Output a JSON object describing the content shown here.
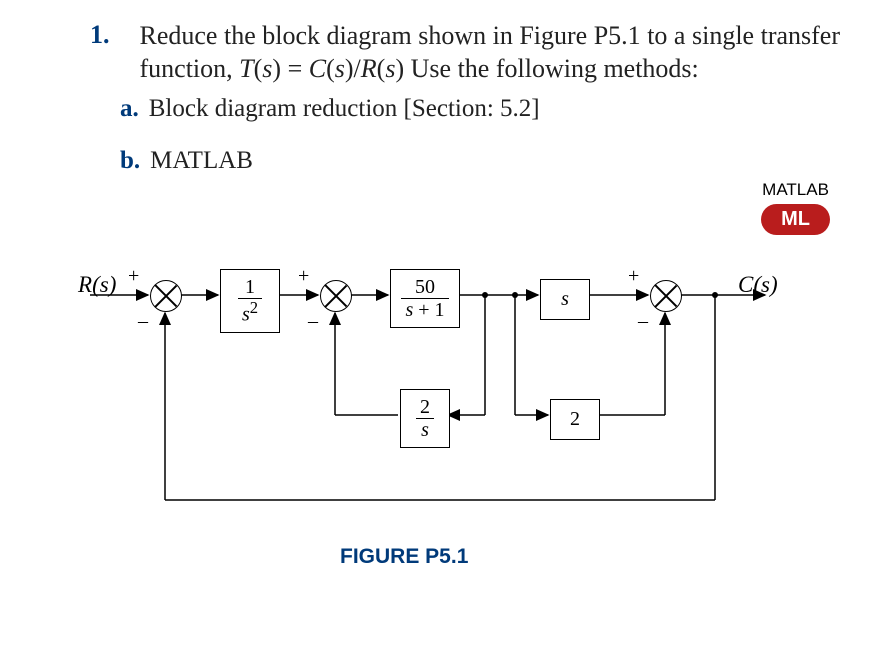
{
  "problem": {
    "number": "1.",
    "text_line1": "Reduce the block diagram shown in Figure P5.1 to a",
    "text_line2": "single transfer function, ",
    "formula": "T(s) = C(s)/R(s)",
    "text_line3": " Use the following methods:",
    "items": {
      "a": {
        "letter": "a.",
        "text": "Block diagram reduction [Section: 5.2]"
      },
      "b": {
        "letter": "b.",
        "text": "MATLAB"
      }
    }
  },
  "badge": {
    "label": "MATLAB",
    "short": "ML"
  },
  "figure": {
    "input": "R(s)",
    "output": "C(s)",
    "input_plus": "+",
    "sum1_minus": "–",
    "sum2_plus": "+",
    "sum2_minus": "–",
    "sum3_plus": "+",
    "sum3_minus": "–",
    "block_g1_num": "1",
    "block_g1_den": "s²",
    "block_g2_num": "50",
    "block_g2_den": "s + 1",
    "block_g3": "s",
    "block_h1_num": "2",
    "block_h1_den": "s",
    "block_h2": "2",
    "caption": "FIGURE P5.1"
  }
}
